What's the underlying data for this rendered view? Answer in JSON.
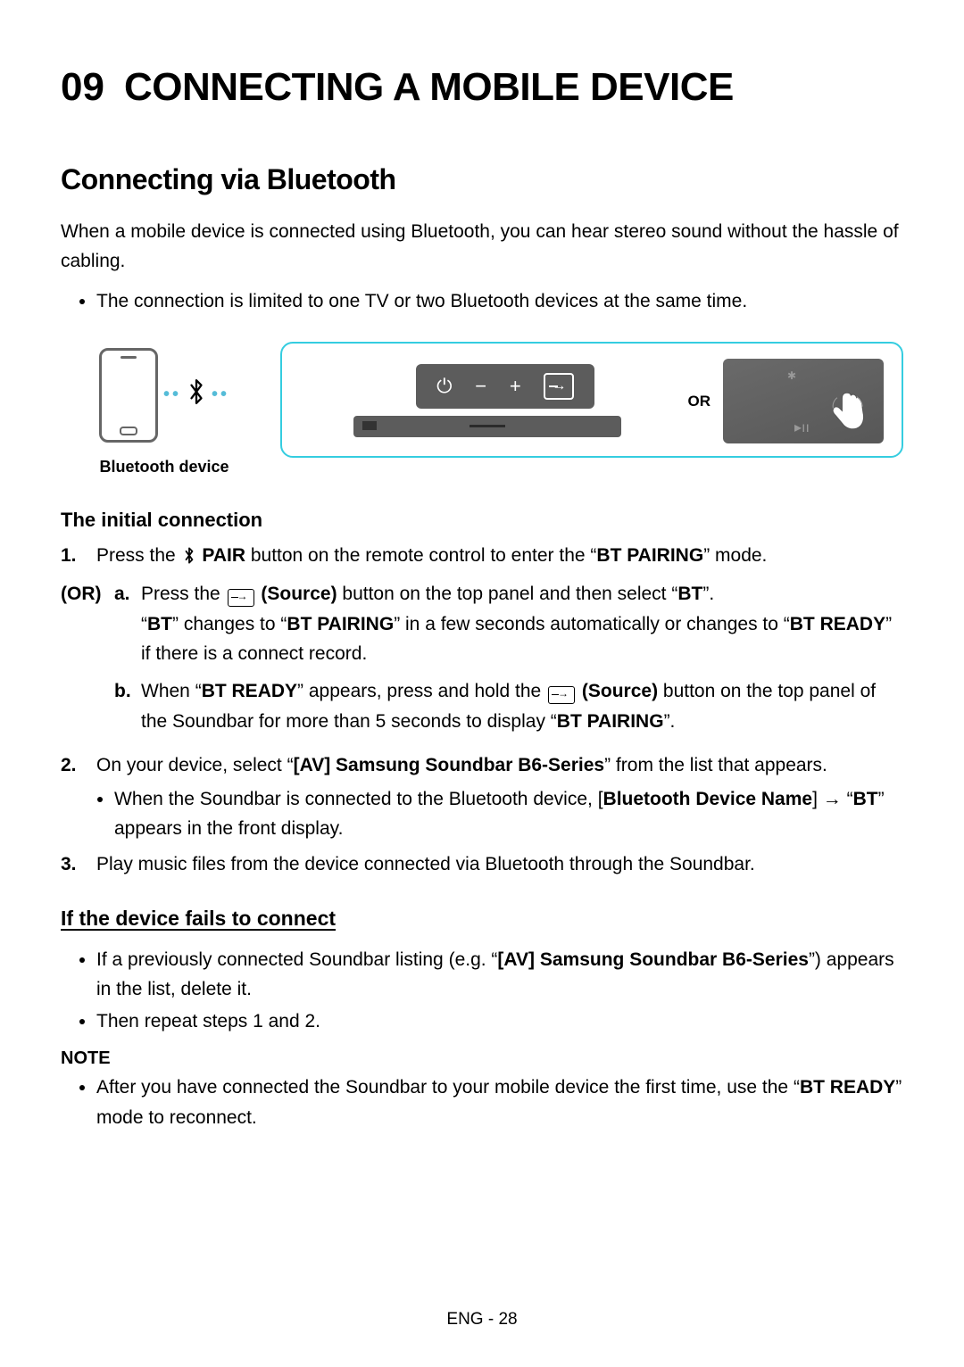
{
  "heading": {
    "number": "09",
    "title": "CONNECTING A MOBILE DEVICE"
  },
  "section1": {
    "title": "Connecting via Bluetooth",
    "intro": "When a mobile device is connected using Bluetooth, you can hear stereo sound without the hassle of cabling.",
    "bullet": "The connection is limited to one TV or two Bluetooth devices at the same time."
  },
  "diagram": {
    "bt_device_label": "Bluetooth device",
    "or_label": "OR"
  },
  "initial_connection": {
    "title": "The initial connection",
    "step1_a": "Press the ",
    "step1_pair": " PAIR",
    "step1_b": " button on the remote control to enter the “",
    "step1_mode": "BT PAIRING",
    "step1_c": "” mode.",
    "or_label": "(OR)",
    "sub_a": {
      "line1_a": "Press the ",
      "line1_src": " (Source)",
      "line1_b": " button on the top panel and then select “",
      "line1_bt": "BT",
      "line1_c": "”.",
      "line2_a": "“",
      "line2_bt": "BT",
      "line2_b": "” changes to “",
      "line2_pair": "BT PAIRING",
      "line2_c": "” in a few seconds automatically or changes to “",
      "line2_ready": "BT READY",
      "line2_d": "” if there is a connect record."
    },
    "sub_b": {
      "line_a": "When “",
      "line_ready": "BT READY",
      "line_b": "” appears, press and hold the ",
      "line_src": " (Source)",
      "line_c": " button on the top panel of the Soundbar for more than 5 seconds to display “",
      "line_pair": "BT PAIRING",
      "line_d": "”."
    },
    "step2_a": "On your device, select “",
    "step2_name": "[AV] Samsung Soundbar B6-Series",
    "step2_b": "” from the list that appears.",
    "step2_sub_a": "When the Soundbar is connected to the Bluetooth device, [",
    "step2_sub_name": "Bluetooth Device Name",
    "step2_sub_b": "] → “",
    "step2_sub_bt": "BT",
    "step2_sub_c": "” appears in the front display.",
    "step3": "Play music files from the device connected via Bluetooth through the Soundbar."
  },
  "fail_section": {
    "title": "If the device fails to connect",
    "bullet1_a": "If a previously connected Soundbar listing (e.g. “",
    "bullet1_name": "[AV] Samsung Soundbar B6-Series",
    "bullet1_b": "”) appears in the list, delete it.",
    "bullet2": "Then repeat steps 1 and 2."
  },
  "note": {
    "label": "NOTE",
    "text_a": "After you have connected the Soundbar to your mobile device the first time, use the “",
    "text_ready": "BT READY",
    "text_b": "” mode to reconnect."
  },
  "footer": "ENG - 28"
}
